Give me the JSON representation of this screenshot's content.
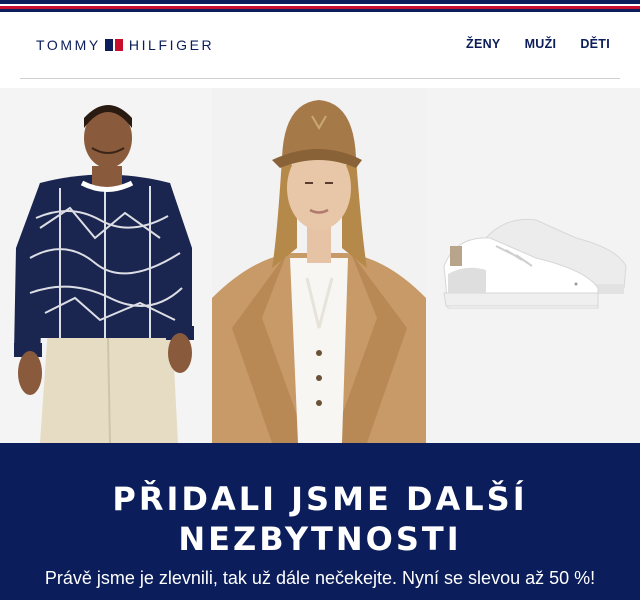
{
  "brand": {
    "logo_left": "TOMMY",
    "logo_right": "HILFIGER"
  },
  "nav": {
    "items": [
      {
        "label": "ŽENY"
      },
      {
        "label": "MUŽI"
      },
      {
        "label": "DĚTI"
      }
    ]
  },
  "banner": {
    "headline_line1": "PŘIDALI JSME DALŠÍ",
    "headline_line2": "NEZBYTNOSTI",
    "body": "Právě jsme je zlevnili, tak už dále nečekejte. Nyní se slevou až 50 %!"
  },
  "colors": {
    "brand_navy": "#0b1d5a",
    "brand_red": "#c8102e",
    "white": "#ffffff"
  }
}
